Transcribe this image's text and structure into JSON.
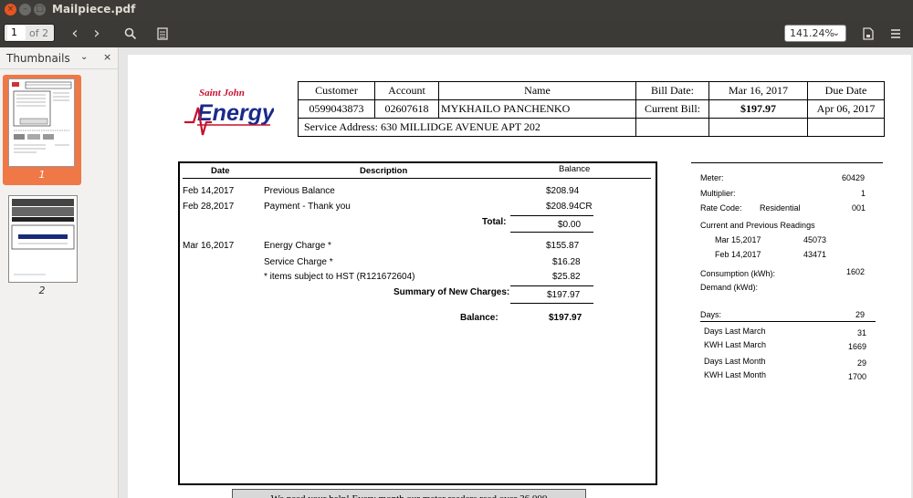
{
  "window": {
    "title": "Mailpiece.pdf",
    "close_glyph": "×",
    "min_glyph": "–",
    "max_glyph": "□"
  },
  "toolbar": {
    "page_current": "1",
    "page_of": "of 2",
    "prev_glyph": "‹",
    "next_glyph": "›",
    "search_glyph": "⚲",
    "annot_glyph": "▤",
    "zoom": "141.24%",
    "zoom_chevron": "⌄",
    "save_glyph": "🗎",
    "menu_glyph": "≡"
  },
  "sidebar": {
    "title": "Thumbnails",
    "chevron": "⌄",
    "close": "×",
    "thumbnails": [
      {
        "label": "1",
        "selected": true
      },
      {
        "label": "2",
        "selected": false
      }
    ]
  },
  "document": {
    "logo": {
      "line1": "Saint John",
      "line2": "Energy"
    },
    "header": {
      "customer_label": "Customer",
      "account_label": "Account",
      "name_label": "Name",
      "bill_date_label": "Bill Date:",
      "bill_date": "Mar 16, 2017",
      "due_date_label": "Due Date",
      "customer": "0599043873",
      "account": "02607618",
      "name": "MYKHAILO PANCHENKO",
      "current_bill_label": "Current Bill:",
      "current_bill": "$197.97",
      "due_date": "Apr 06, 2017",
      "service_address_label": "Service Address:",
      "service_address": "630 MILLIDGE AVENUE  APT 202"
    },
    "charges": {
      "col_date": "Date",
      "col_description": "Description",
      "col_balance": "Balance",
      "rows": [
        {
          "date": "Feb 14,2017",
          "description": "Previous Balance",
          "amount": "$208.94"
        },
        {
          "date": "Feb 28,2017",
          "description": "Payment - Thank you",
          "amount": "$208.94CR"
        }
      ],
      "total_label": "Total:",
      "total": "$0.00",
      "new_rows": [
        {
          "date": "Mar 16,2017",
          "description": "Energy Charge *",
          "amount": "$155.87"
        },
        {
          "date": "",
          "description": "Service Charge *",
          "amount": "$16.28"
        },
        {
          "date": "",
          "description": "* items subject to HST (R121672604)",
          "amount": "$25.82"
        }
      ],
      "summary_label": "Summary of New Charges:",
      "summary": "$197.97",
      "balance_label": "Balance:",
      "balance": "$197.97"
    },
    "meter": {
      "meter_label": "Meter:",
      "meter": "60429",
      "multiplier_label": "Multiplier:",
      "multiplier": "1",
      "rate_code_label": "Rate Code:",
      "rate_code_type": "Residential",
      "rate_code": "001",
      "readings_label": "Current and Previous Readings",
      "readings": [
        {
          "date": "Mar 15,2017",
          "value": "45073"
        },
        {
          "date": "Feb 14,2017",
          "value": "43471"
        }
      ],
      "consumption_label": "Consumption (kWh):",
      "consumption": "1602",
      "demand_label": "Demand (kWd):",
      "days_label": "Days:",
      "days": "29",
      "history": [
        {
          "label": "Days Last March",
          "value": "31"
        },
        {
          "label": "KWH Last March",
          "value": "1669"
        },
        {
          "label": "Days Last Month",
          "value": "29"
        },
        {
          "label": "KWH Last Month",
          "value": "1700"
        }
      ]
    },
    "banner": "We need your help! Every month our meter readers read over 36,000"
  }
}
